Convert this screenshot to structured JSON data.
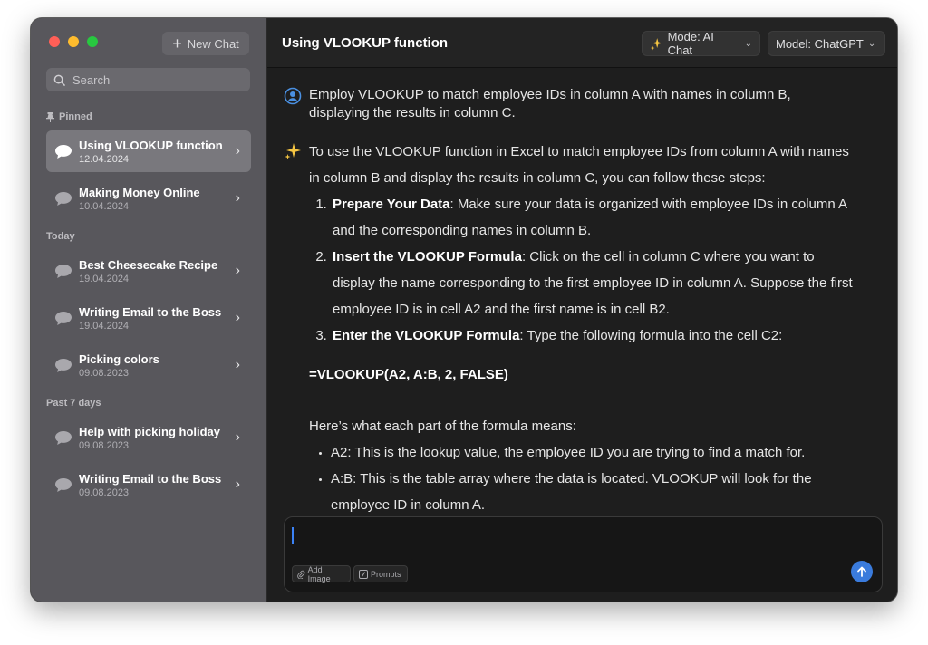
{
  "sidebar": {
    "new_chat_label": "New Chat",
    "search_placeholder": "Search",
    "sections": {
      "pinned": "Pinned",
      "today": "Today",
      "past7": "Past 7 days"
    },
    "items": [
      {
        "title": "Using VLOOKUP function",
        "date": "12.04.2024"
      },
      {
        "title": "Making Money Online",
        "date": "10.04.2024"
      },
      {
        "title": "Best Cheesecake Recipe",
        "date": "19.04.2024"
      },
      {
        "title": "Writing Email to the Boss",
        "date": "19.04.2024"
      },
      {
        "title": "Picking colors",
        "date": "09.08.2023"
      },
      {
        "title": "Help with picking holiday",
        "date": "09.08.2023"
      },
      {
        "title": "Writing Email to the Boss",
        "date": "09.08.2023"
      }
    ]
  },
  "header": {
    "title": "Using VLOOKUP function",
    "mode_label": "Mode: AI Chat",
    "model_label": "Model: ChatGPT"
  },
  "conversation": {
    "user_message": "Employ VLOOKUP to match employee IDs in column A with names in column B, displaying the results in column C.",
    "ai_intro": "To use the VLOOKUP function in Excel to match employee IDs from column A with names in column B and display the results in column C, you can follow these steps:",
    "steps": [
      {
        "bold": "Prepare Your Data",
        "text": ": Make sure your data is organized with employee IDs in column A and the corresponding names in column B."
      },
      {
        "bold": "Insert the VLOOKUP Formula",
        "text": ": Click on the cell in column C where you want to display the name corresponding to the first employee ID in column A. Suppose the first employee ID is in cell A2 and the first name is in cell B2."
      },
      {
        "bold": "Enter the VLOOKUP Formula",
        "text": ": Type the following formula into the cell C2:"
      }
    ],
    "formula": "=VLOOKUP(A2, A:B, 2, FALSE)",
    "explain_intro": "Here’s what each part of the formula means:",
    "bullets": [
      "A2: This is the lookup value, the employee ID you are trying to find a match for.",
      "A:B: This is the table array where the data is located. VLOOKUP will look for the employee ID in column A."
    ]
  },
  "composer": {
    "add_image_label": "Add Image",
    "prompts_label": "Prompts"
  },
  "colors": {
    "accent": "#3a7bdc",
    "sidebar_bg": "#58575c",
    "main_bg": "#1e1e1e"
  }
}
